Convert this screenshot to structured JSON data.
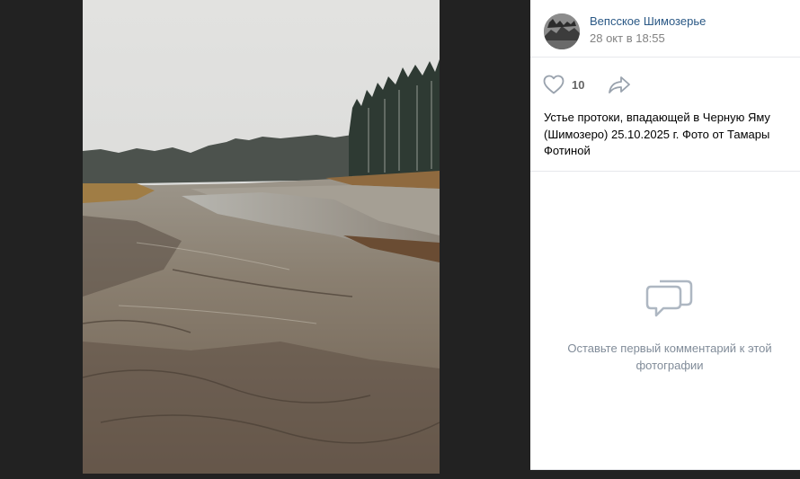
{
  "post": {
    "author": "Вепсское Шимозерье",
    "date": "28 окт в 18:55",
    "likes": "10",
    "caption": "Устье протоки, впадающей в Черную Яму (Шимозеро) 25.10.2025 г. Фото от Тамары Фотиной"
  },
  "comments": {
    "empty_text": "Оставьте первый комментарий к этой фотографии"
  },
  "icons": {
    "like": "heart-outline-icon",
    "share": "share-arrow-icon",
    "comments": "speech-bubbles-icon"
  },
  "colors": {
    "link": "#2a5885",
    "muted": "#828282",
    "icon": "#99a2ad",
    "hint": "#818c99",
    "backdrop": "#222222"
  }
}
